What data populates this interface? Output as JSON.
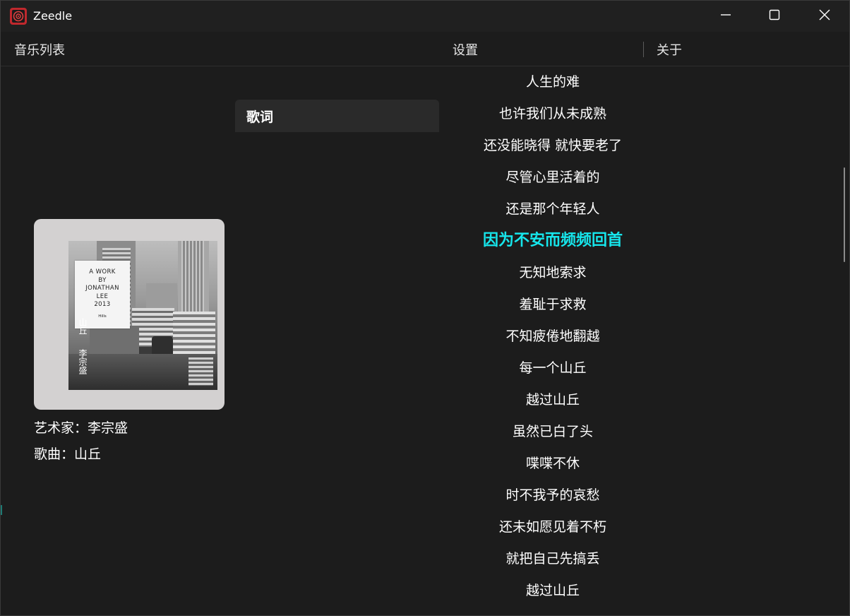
{
  "window": {
    "title": "Zeedle"
  },
  "icons": {
    "app": "zeedle-app-icon",
    "minimize": "minimize-icon",
    "maximize": "maximize-icon",
    "close": "close-icon"
  },
  "tabs": [
    {
      "label": "音乐列表",
      "active": false
    },
    {
      "label": "歌词",
      "active": true
    },
    {
      "label": "设置",
      "active": false
    },
    {
      "label": "关于",
      "active": false
    }
  ],
  "now_playing": {
    "artist_line": "艺术家：李宗盛",
    "song_line": "歌曲：山丘",
    "cover": {
      "card_lines": [
        "A WORK",
        "BY",
        "JONATHAN",
        "LEE",
        "2013"
      ],
      "card_small": "Hills",
      "title_vertical": "山丘",
      "artist_vertical": "李宗盛"
    }
  },
  "lyrics": {
    "current_index": 5,
    "lines": [
      "人生的难",
      "也许我们从未成熟",
      "还没能晓得 就快要老了",
      "尽管心里活着的",
      "还是那个年轻人",
      "因为不安而频频回首",
      "无知地索求",
      "羞耻于求救",
      "不知疲倦地翻越",
      "每一个山丘",
      "越过山丘",
      "虽然已白了头",
      "喋喋不休",
      "时不我予的哀愁",
      "还未如愿见着不朽",
      "就把自己先搞丢",
      "越过山丘"
    ]
  },
  "colors": {
    "background": "#1c1c1c",
    "active_tab": "#2a2a2a",
    "highlight_lyric": "#16e6ec",
    "text": "#ffffff"
  }
}
